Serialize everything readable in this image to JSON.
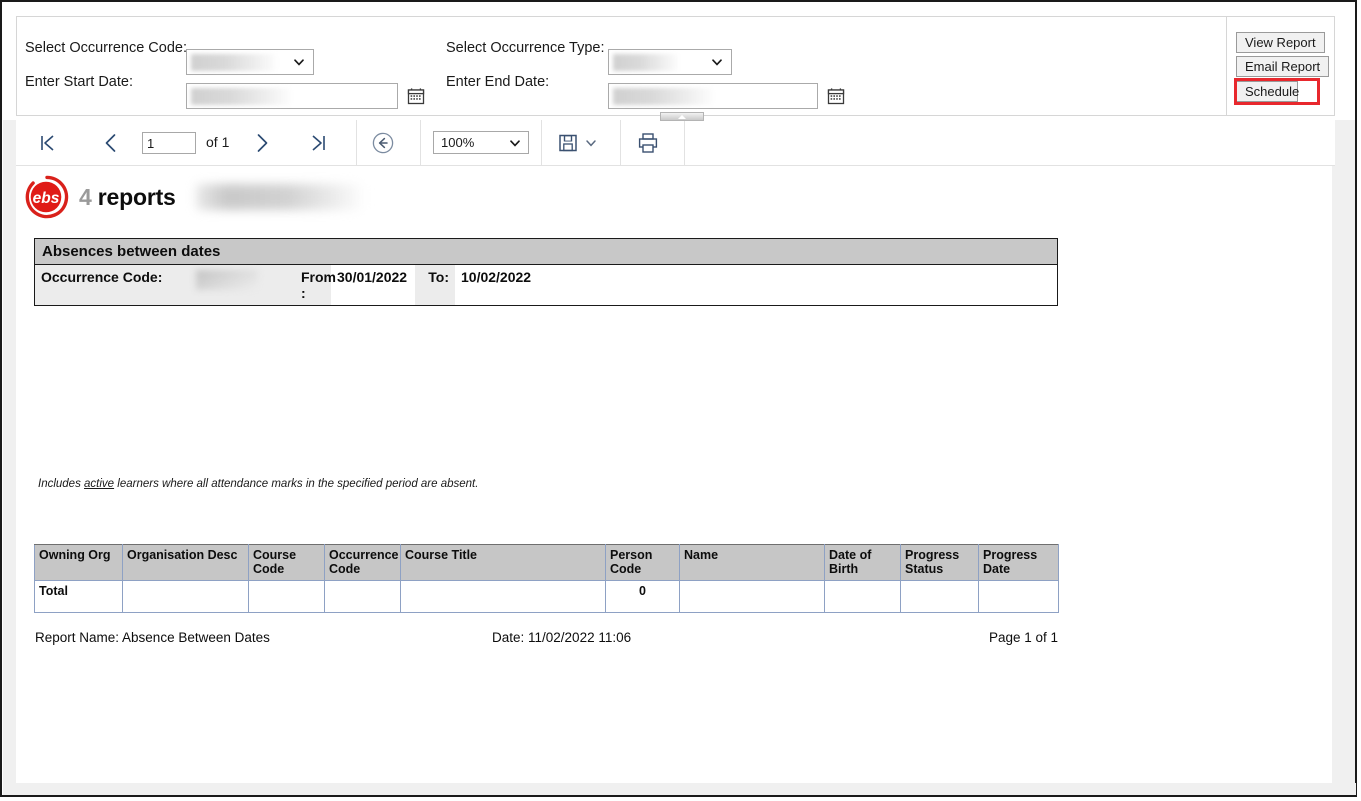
{
  "parameters": {
    "occurrence_code_label": "Select Occurrence Code:",
    "occurrence_code_value": "",
    "occurrence_type_label": "Select Occurrence Type:",
    "occurrence_type_value": "",
    "start_date_label": "Enter Start Date:",
    "start_date_value": "",
    "end_date_label": "Enter End Date:",
    "end_date_value": "",
    "calendar_icon": "calendar-icon",
    "buttons": {
      "view_report": "View Report",
      "email_report": "Email Report",
      "schedule": "Schedule"
    },
    "highlight_color": "#e8282d"
  },
  "toolbar": {
    "first_page_icon": "first-page-icon",
    "previous_page_icon": "previous-page-icon",
    "next_page_icon": "next-page-icon",
    "last_page_icon": "last-page-icon",
    "back_icon": "back-arrow-icon",
    "page_number": "1",
    "page_total_label": "of 1",
    "zoom_level": "100%",
    "save_icon": "save-floppy-icon",
    "save_chevron_icon": "chevron-down-icon",
    "print_icon": "print-icon",
    "collapse_handle_icon": "collapse-up-icon"
  },
  "report": {
    "logo_text": "ebs",
    "title_prefix": "4",
    "title": " reports",
    "section_title": "Absences between dates",
    "fields": {
      "occurrence_code_label": "Occurrence Code:",
      "occurrence_code_value": "",
      "from_label": "From :",
      "from_value": "30/01/2022",
      "to_label": "To:",
      "to_value": "10/02/2022"
    },
    "note_prefix": "Includes ",
    "note_emphasis": "active",
    "note_suffix": " learners where all attendance marks in the specified period are absent.",
    "table": {
      "columns": [
        "Owning Org",
        "Organisation Desc",
        "Course Code",
        "Occurrence Code",
        "Course Title",
        "Person Code",
        "Name",
        "Date of Birth",
        "Progress Status",
        "Progress Date"
      ],
      "rows": [
        {
          "owning_org": "Total",
          "organisation_desc": "",
          "course_code": "",
          "occurrence_code": "",
          "course_title": "",
          "person_code": "0",
          "name": "",
          "date_of_birth": "",
          "progress_status": "",
          "progress_date": ""
        }
      ]
    },
    "footer": {
      "report_name": "Report Name: Absence Between Dates",
      "date": "Date: 11/02/2022 11:06",
      "page": "Page 1 of 1"
    }
  }
}
